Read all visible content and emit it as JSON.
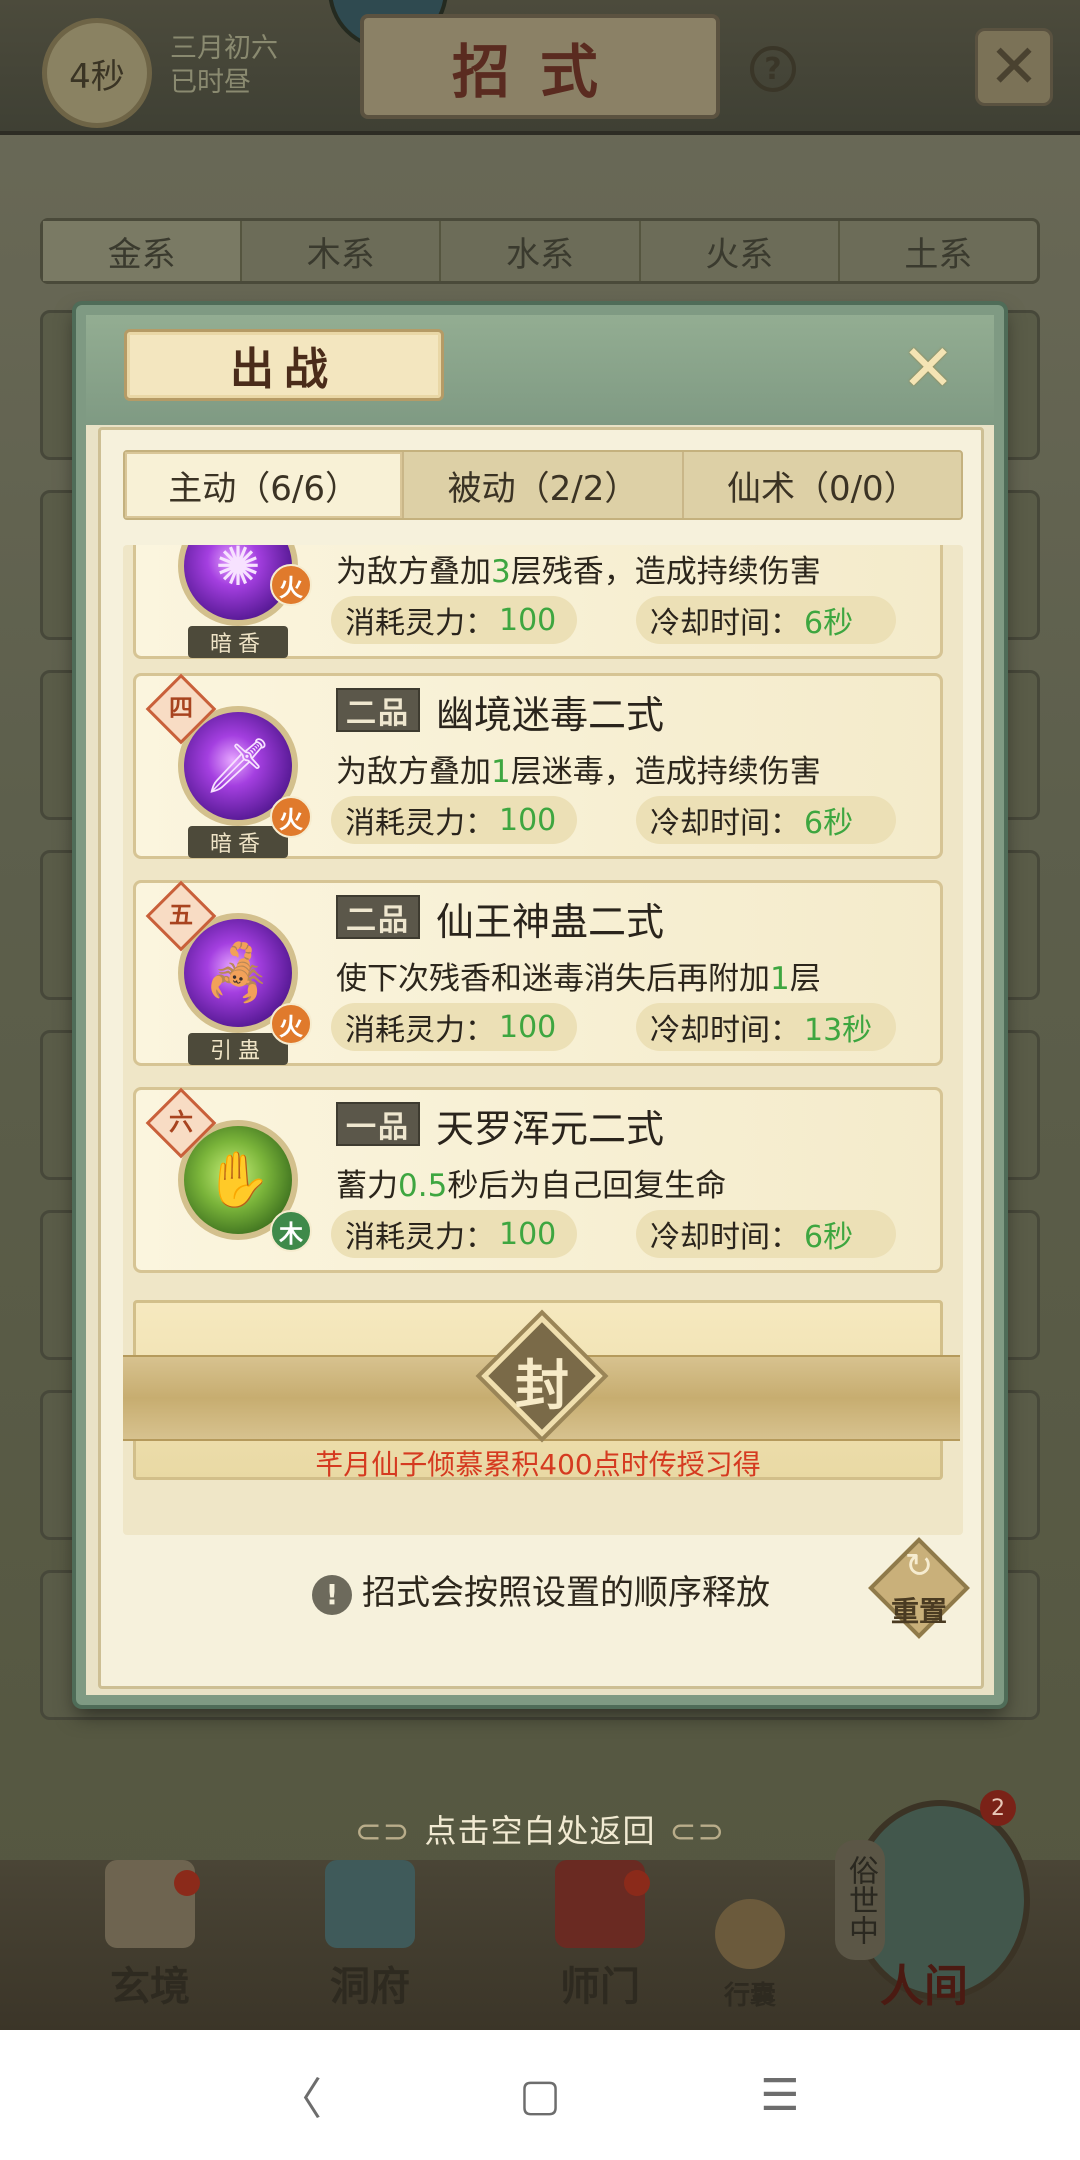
{
  "topbar": {
    "timer": "4秒",
    "date_line1": "三月初六",
    "date_line2": "已时昼",
    "title": "招式",
    "help_icon": "question-circle-icon",
    "close_icon": "close-x-icon"
  },
  "element_tabs": [
    "金系",
    "木系",
    "水系",
    "火系",
    "土系"
  ],
  "modal": {
    "title": "出战",
    "close_icon": "close-x-icon",
    "tabs": [
      "主动（6/6）",
      "被动（2/2）",
      "仙术（0/0）"
    ],
    "active_tab": 0,
    "stat_cost_label": "消耗灵力：",
    "stat_cd_label": "冷却时间：",
    "skills": [
      {
        "rank": "",
        "grade": "",
        "name": "",
        "desc_pre": "为敌方叠加",
        "desc_num": "3",
        "desc_post": "层残香，造成持续伤害",
        "icon_label": "暗香",
        "element": "火",
        "cost": "100",
        "cooldown": "6秒"
      },
      {
        "rank": "四",
        "grade": "二品",
        "name": "幽境迷毒二式",
        "desc_pre": "为敌方叠加",
        "desc_num": "1",
        "desc_post": "层迷毒，造成持续伤害",
        "icon_label": "暗香",
        "element": "火",
        "cost": "100",
        "cooldown": "6秒"
      },
      {
        "rank": "五",
        "grade": "二品",
        "name": "仙王神蛊二式",
        "desc_pre": "使下次残香和迷毒消失后再附加",
        "desc_num": "1",
        "desc_post": "层",
        "icon_label": "引蛊",
        "element": "火",
        "cost": "100",
        "cooldown": "13秒"
      },
      {
        "rank": "六",
        "grade": "一品",
        "name": "天罗浑元二式",
        "desc_pre": "蓄力",
        "desc_num": "0.5",
        "desc_post": "秒后为自己回复生命",
        "icon_label": "",
        "element": "木",
        "cost": "100",
        "cooldown": "6秒"
      }
    ],
    "sealed": {
      "seal_char": "封",
      "unlock_text": "芊月仙子倾慕累积400点时传授习得"
    },
    "order_hint": "招式会按照设置的顺序释放",
    "reset_label": "重置"
  },
  "bottom": {
    "hint": "点击空白处返回",
    "nav": [
      "玄境",
      "洞府",
      "师门",
      "行囊"
    ],
    "world_tag": "俗世中",
    "world_label": "人间",
    "world_badge": "2"
  },
  "sysbar": {
    "back": "〈",
    "home": "▢",
    "menu": "☰"
  }
}
